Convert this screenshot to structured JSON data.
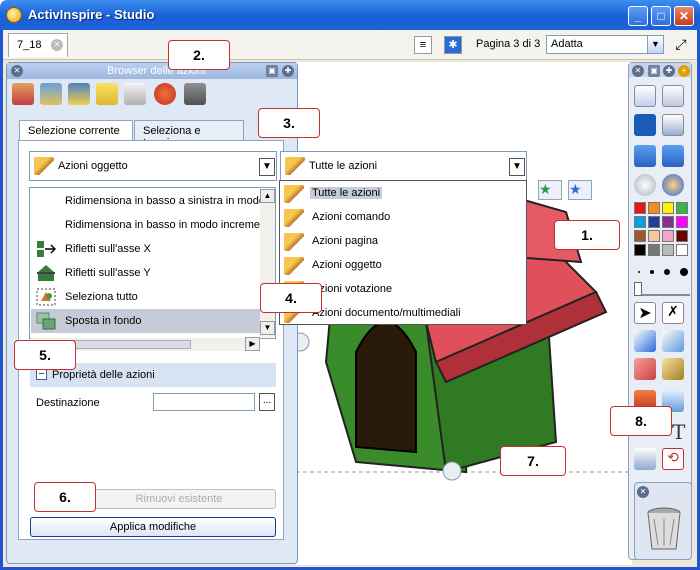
{
  "window": {
    "title": "ActivInspire - Studio"
  },
  "doc_tab": {
    "label": "7_18"
  },
  "page_nav": {
    "page_info": "Pagina 3 di 3",
    "zoom_value": "Adatta"
  },
  "browser": {
    "title": "Browser delle azioni",
    "tabs": [
      {
        "label": "Selezione corrente"
      },
      {
        "label": "Seleziona e trascina"
      }
    ],
    "category_combo": {
      "value": "Azioni oggetto"
    },
    "filter_combo": {
      "value": "Tutte le azioni"
    },
    "actions": [
      {
        "label": "Ridimensiona in basso a sinistra in modo i"
      },
      {
        "label": "Ridimensiona in basso in modo incrementa"
      },
      {
        "label": "Rifletti sull'asse X"
      },
      {
        "label": "Rifletti sull'asse Y"
      },
      {
        "label": "Seleziona tutto"
      },
      {
        "label": "Sposta in fondo"
      }
    ],
    "properties_header": "Proprietà delle azioni",
    "destination_label": "Destinazione",
    "destination_value": "",
    "browse_label": "...",
    "remove_button": "Rimuovi esistente",
    "apply_button": "Applica modifiche"
  },
  "filter_popup": {
    "items": [
      {
        "label": "Tutte le azioni"
      },
      {
        "label": "Azioni comando"
      },
      {
        "label": "Azioni pagina"
      },
      {
        "label": "Azioni oggetto"
      },
      {
        "label": "Azioni votazione"
      },
      {
        "label": "Azioni documento/multimediali"
      }
    ]
  },
  "callouts": [
    "1.",
    "2.",
    "3.",
    "4.",
    "5.",
    "6.",
    "7.",
    "8."
  ],
  "colors": {
    "palette": [
      "#e8161c",
      "#f58d1c",
      "#fff200",
      "#39b54a",
      "#00a3e0",
      "#1e3f9c",
      "#8a2e8e",
      "#ff00ff",
      "#9a5a2a",
      "#f5c8a0",
      "#f4a4c4",
      "#6a0000",
      "#000000",
      "#777777",
      "#bbbbbb",
      "#ffffff"
    ]
  }
}
